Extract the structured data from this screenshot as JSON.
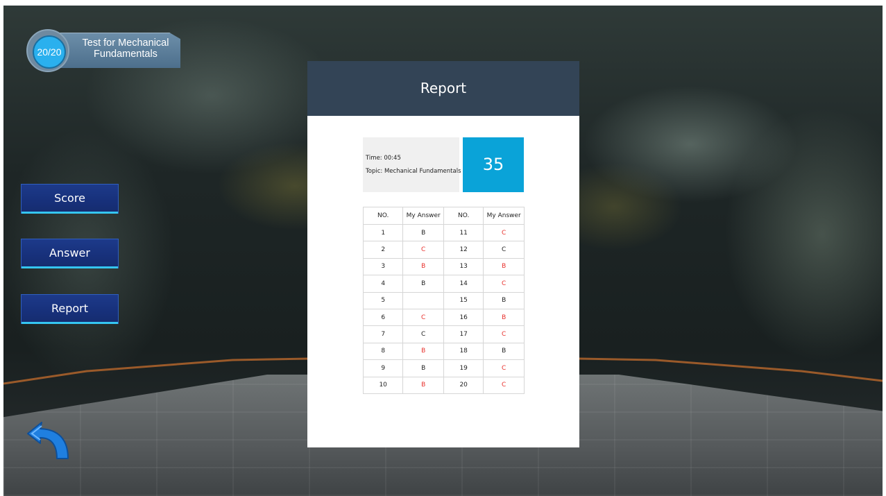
{
  "header": {
    "progress": "20/20",
    "quiz_title": "Test for Mechanical Fundamentals"
  },
  "menu": {
    "score_label": "Score",
    "answer_label": "Answer",
    "report_label": "Report"
  },
  "report": {
    "title": "Report",
    "time": "Time: 00:45",
    "topic": "Topic: Mechanical Fundamentals",
    "score": "35",
    "table": {
      "headers": [
        "NO.",
        "My Answer",
        "NO.",
        "My Answer"
      ],
      "rows": [
        [
          {
            "no": "1",
            "answer": "B",
            "wrong": false
          },
          {
            "no": "11",
            "answer": "C",
            "wrong": true
          }
        ],
        [
          {
            "no": "2",
            "answer": "C",
            "wrong": true
          },
          {
            "no": "12",
            "answer": "C",
            "wrong": false
          }
        ],
        [
          {
            "no": "3",
            "answer": "B",
            "wrong": true
          },
          {
            "no": "13",
            "answer": "B",
            "wrong": true
          }
        ],
        [
          {
            "no": "4",
            "answer": "B",
            "wrong": false
          },
          {
            "no": "14",
            "answer": "C",
            "wrong": true
          }
        ],
        [
          {
            "no": "5",
            "answer": "",
            "wrong": false
          },
          {
            "no": "15",
            "answer": "B",
            "wrong": false
          }
        ],
        [
          {
            "no": "6",
            "answer": "C",
            "wrong": true
          },
          {
            "no": "16",
            "answer": "B",
            "wrong": true
          }
        ],
        [
          {
            "no": "7",
            "answer": "C",
            "wrong": false
          },
          {
            "no": "17",
            "answer": "C",
            "wrong": true
          }
        ],
        [
          {
            "no": "8",
            "answer": "B",
            "wrong": true
          },
          {
            "no": "18",
            "answer": "B",
            "wrong": false
          }
        ],
        [
          {
            "no": "9",
            "answer": "B",
            "wrong": false
          },
          {
            "no": "19",
            "answer": "C",
            "wrong": true
          }
        ],
        [
          {
            "no": "10",
            "answer": "B",
            "wrong": true
          },
          {
            "no": "20",
            "answer": "C",
            "wrong": true
          }
        ]
      ]
    }
  },
  "colors": {
    "header_bg": "#334456",
    "score_bg": "#0aa3d8",
    "wrong_answer": "#e8302b",
    "menu_button": "#1d3a8a",
    "menu_accent": "#35c6f2",
    "badge_circle": "#2ab0ee"
  },
  "icons": {
    "back": "back-arrow-icon"
  }
}
